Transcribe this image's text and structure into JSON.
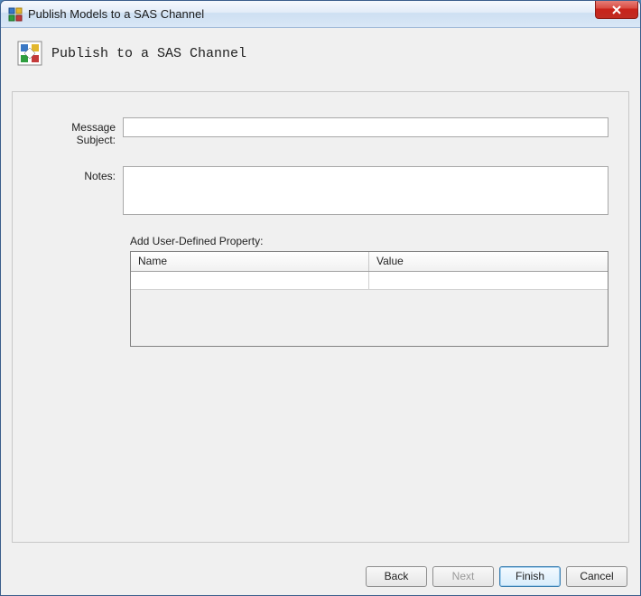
{
  "window": {
    "title": "Publish Models to a SAS Channel"
  },
  "header": {
    "title": "Publish to a SAS Channel"
  },
  "form": {
    "messageSubjectLabel": "Message Subject:",
    "messageSubjectValue": "",
    "notesLabel": "Notes:",
    "notesValue": "",
    "addPropertyLabel": "Add User-Defined Property:",
    "table": {
      "col1": "Name",
      "col2": "Value",
      "row1": {
        "name": "",
        "value": ""
      }
    }
  },
  "buttons": {
    "back": "Back",
    "next": "Next",
    "finish": "Finish",
    "cancel": "Cancel"
  }
}
